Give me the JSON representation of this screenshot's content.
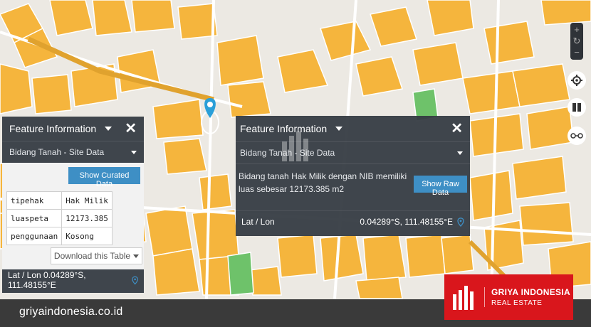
{
  "colors": {
    "parcel": "#f5b53d",
    "parcel_stroke": "#ffffff",
    "green": "#6ec26a",
    "road": "#ffffff",
    "panel": "#343a42",
    "accent": "#3e8fc5",
    "brand": "#d9161c",
    "footer": "#3a3a3a"
  },
  "left_panel": {
    "title": "Feature Information",
    "layer": "Bidang Tanah - Site Data",
    "show_button": "Show Curated Data",
    "rows": [
      {
        "key": "tipehak",
        "value": "Hak Milik"
      },
      {
        "key": "luaspeta",
        "value": "12173.385"
      },
      {
        "key": "penggunaan",
        "value": "Kosong"
      }
    ],
    "download": "Download this Table",
    "latlon": "Lat / Lon 0.04289°S, 111.48155°E",
    "icons": {
      "close": "close-icon",
      "dropdown": "chevron-down-icon",
      "location": "location-pin-icon"
    }
  },
  "right_panel": {
    "title": "Feature Information",
    "layer": "Bidang Tanah - Site Data",
    "description": "Bidang tanah Hak Milik dengan NIB memiliki luas sebesar 12173.385 m2",
    "show_button": "Show Raw Data",
    "latlon_label": "Lat / Lon",
    "latlon_value": "0.04289°S, 111.48155°E"
  },
  "map_controls": {
    "icons": [
      "zoom-in-icon",
      "reset-rotation-icon",
      "zoom-out-icon",
      "locate-icon",
      "compare-icon",
      "layers-icon"
    ]
  },
  "footer": {
    "site": "griyaindonesia.co.id"
  },
  "brand": {
    "line1": "GRIYA INDONESIA",
    "line2": "REAL ESTATE"
  }
}
